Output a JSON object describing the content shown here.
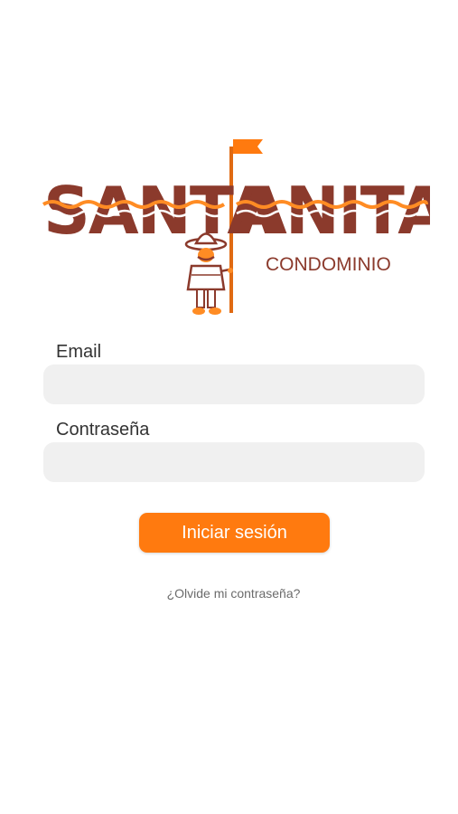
{
  "brand": {
    "logo_line1": "SANTA",
    "logo_line2": "ANITA",
    "subtitle": "CONDOMINIO",
    "brand_color": "#8b3a2c",
    "accent_color": "#ff7a0f"
  },
  "form": {
    "email_label": "Email",
    "email_value": "",
    "email_placeholder": "",
    "password_label": "Contraseña",
    "password_value": "",
    "password_placeholder": "",
    "submit_label": "Iniciar sesión",
    "forgot_label": "¿Olvide mi contraseña?"
  },
  "colors": {
    "input_bg": "#f0f0f0",
    "button_bg": "#ff7a0f",
    "label_text": "#333333",
    "link_text": "#6b6b6b"
  },
  "icons": [
    "mascot-logo-icon",
    "flag-icon"
  ]
}
